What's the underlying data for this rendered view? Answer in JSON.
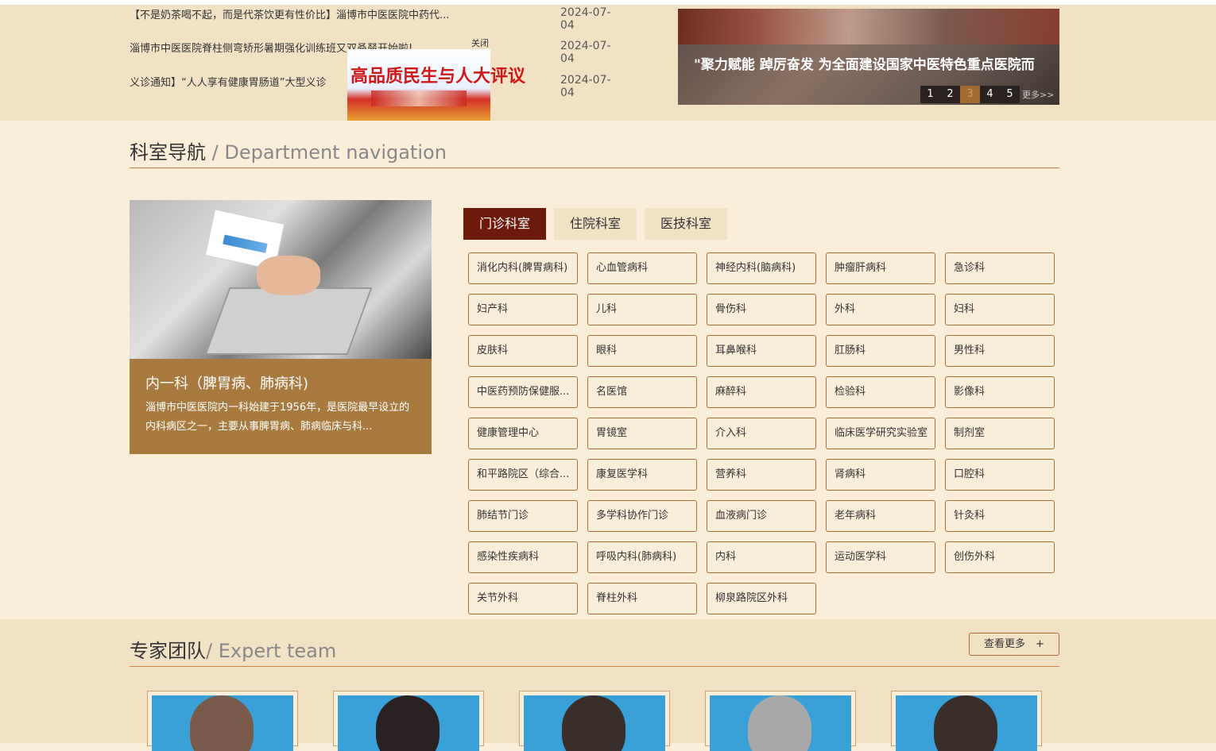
{
  "news": [
    {
      "title": "【不是奶茶喝不起，而是代茶饮更有性价比】淄博市中医医院中药代...",
      "date": "2024-07-04"
    },
    {
      "title": "淄博市中医医院脊柱侧弯矫形暑期强化训练班又双叒叕开始啦!",
      "date": "2024-07-04"
    },
    {
      "title": "义诊通知】“人人享有健康胃肠道”大型义诊",
      "date": "2024-07-04"
    }
  ],
  "ad": {
    "title": "高品质民生与人大评议",
    "close_label": "关闭"
  },
  "slider": {
    "caption": "\"聚力赋能 踔厉奋发 为全面建设国家中医特色重点医院而",
    "pages": [
      "1",
      "2",
      "3",
      "4",
      "5"
    ],
    "active_page": "3",
    "more_label": "更多>>"
  },
  "dept_nav": {
    "title": "科室导航",
    "title_en": " / Department navigation",
    "card": {
      "name": "内一科（脾胃病、肺病科)",
      "desc": "淄博市中医医院内一科始建于1956年，是医院最早设立的内科病区之一，主要从事脾胃病、肺病临床与科..."
    },
    "tabs": [
      "门诊科室",
      "住院科室",
      "医技科室"
    ],
    "active_tab": "门诊科室",
    "departments": [
      "消化内科(脾胃病科)",
      "心血管病科",
      "神经内科(脑病科)",
      "肿瘤肝病科",
      "急诊科",
      "妇产科",
      "儿科",
      "骨伤科",
      "外科",
      "妇科",
      "皮肤科",
      "眼科",
      "耳鼻喉科",
      "肛肠科",
      "男性科",
      "中医药预防保健服...",
      "名医馆",
      "麻醉科",
      "检验科",
      "影像科",
      "健康管理中心",
      "胃镜室",
      "介入科",
      "临床医学研究实验室",
      "制剂室",
      "和平路院区（综合...",
      "康复医学科",
      "营养科",
      "肾病科",
      "口腔科",
      "肺结节门诊",
      "多学科协作门诊",
      "血液病门诊",
      "老年病科",
      "针灸科",
      "感染性疾病科",
      "呼吸内科(肺病科)",
      "内科",
      "运动医学科",
      "创伤外科",
      "关节外科",
      "脊柱外科",
      "柳泉路院区外科"
    ]
  },
  "experts": {
    "title": "专家团队",
    "title_en": "/ Expert team",
    "more_label": "查看更多　+",
    "photo_bg": "#3aa0d8"
  }
}
